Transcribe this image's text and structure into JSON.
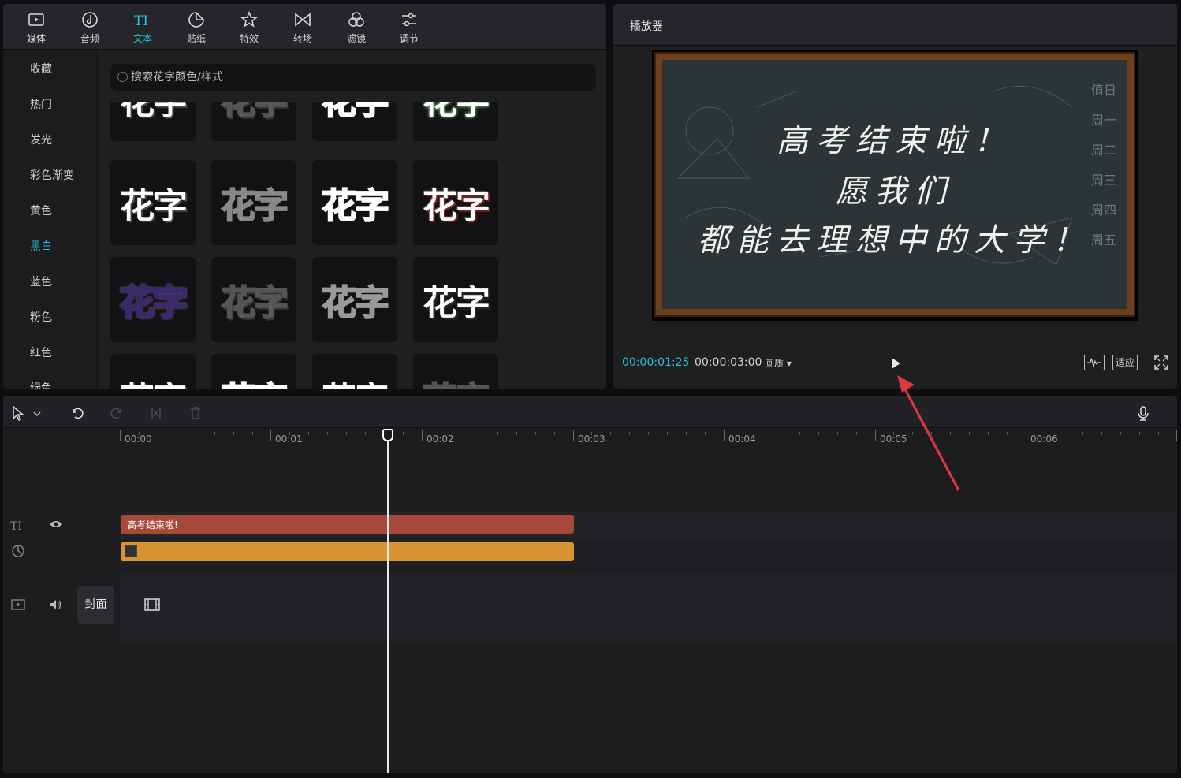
{
  "top_tabs": [
    {
      "label": "媒体",
      "icon": "media-icon"
    },
    {
      "label": "音频",
      "icon": "audio-icon"
    },
    {
      "label": "文本",
      "icon": "text-icon",
      "active": true
    },
    {
      "label": "贴纸",
      "icon": "sticker-icon"
    },
    {
      "label": "特效",
      "icon": "effects-icon"
    },
    {
      "label": "转场",
      "icon": "transition-icon"
    },
    {
      "label": "滤镜",
      "icon": "filter-icon"
    },
    {
      "label": "调节",
      "icon": "adjust-icon"
    }
  ],
  "categories": [
    "收藏",
    "热门",
    "发光",
    "彩色渐变",
    "黄色",
    "黑白",
    "蓝色",
    "粉色",
    "红色",
    "绿色"
  ],
  "active_category": "黑白",
  "search": {
    "placeholder": "搜索花字颜色/样式"
  },
  "tile_text": "花字",
  "player": {
    "title": "播放器",
    "current_time": "00:00:01:25",
    "total_time": "00:00:03:00",
    "quality_label": "画质",
    "fit_label": "适应",
    "board_lines": [
      "高考结束啦！",
      "愿我们",
      "都能去理想中的大学！"
    ],
    "board_days": [
      "值日",
      "周一",
      "周二",
      "周三",
      "周四",
      "周五"
    ]
  },
  "timeline": {
    "ticks": [
      "00:00",
      "00:01",
      "00:02",
      "00:03",
      "00:04",
      "00:05",
      "00:06"
    ],
    "text_clip_label": "高考结束啦!",
    "cover_label": "封面"
  },
  "colors": {
    "accent": "#25c2d8",
    "text_clip": "#a6493a",
    "effect_clip": "#d89332",
    "annotation": "#e0383e"
  }
}
